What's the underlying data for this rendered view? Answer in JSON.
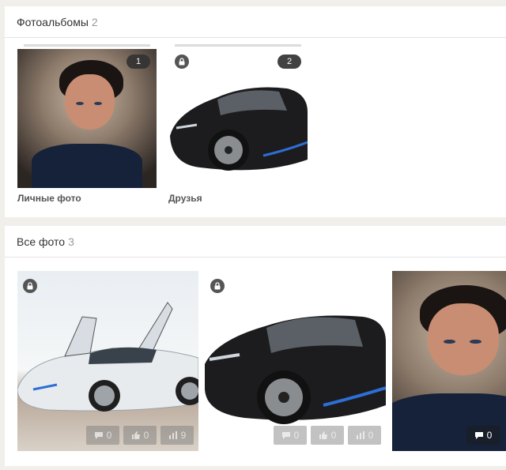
{
  "albums_section": {
    "title": "Фотоальбомы",
    "count": "2",
    "albums": [
      {
        "title": "Личные фото",
        "badge": "1",
        "thumbnail": "portrait-man",
        "locked": false
      },
      {
        "title": "Друзья",
        "badge": "2",
        "thumbnail": "black-sports-car",
        "locked": true
      }
    ]
  },
  "photos_section": {
    "title": "Все фото",
    "count": "3",
    "photos": [
      {
        "thumbnail": "white-sports-car-doors-open",
        "locked": true,
        "comments": "0",
        "likes": "0",
        "views": "9"
      },
      {
        "thumbnail": "black-sports-car",
        "locked": true,
        "comments": "0",
        "likes": "0",
        "views": "0"
      },
      {
        "thumbnail": "portrait-man",
        "locked": false,
        "comments": "0"
      }
    ]
  },
  "colors": {
    "page_background": "#f0efea",
    "panel_background": "#ffffff",
    "badge_background": "#333333",
    "muted_text": "#999999"
  },
  "icons": [
    "lock-icon",
    "comment-icon",
    "like-icon",
    "views-icon"
  ]
}
